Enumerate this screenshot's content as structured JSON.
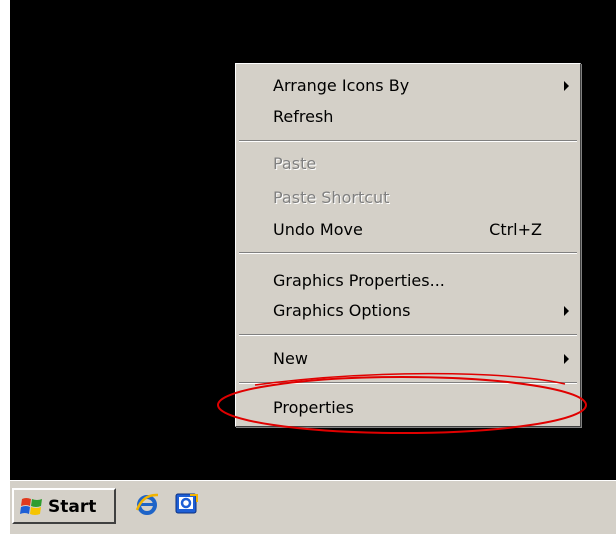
{
  "context_menu": {
    "items": [
      {
        "label": "Arrange Icons By",
        "shortcut": "",
        "submenu": true,
        "disabled": false
      },
      {
        "label": "Refresh",
        "shortcut": "",
        "submenu": false,
        "disabled": false
      },
      {
        "label": "Paste",
        "shortcut": "",
        "submenu": false,
        "disabled": true
      },
      {
        "label": "Paste Shortcut",
        "shortcut": "",
        "submenu": false,
        "disabled": true
      },
      {
        "label": "Undo Move",
        "shortcut": "Ctrl+Z",
        "submenu": false,
        "disabled": false
      },
      {
        "label": "Graphics Properties...",
        "shortcut": "",
        "submenu": false,
        "disabled": false
      },
      {
        "label": "Graphics Options",
        "shortcut": "",
        "submenu": true,
        "disabled": false
      },
      {
        "label": "New",
        "shortcut": "",
        "submenu": true,
        "disabled": false
      },
      {
        "label": "Properties",
        "shortcut": "",
        "submenu": false,
        "disabled": false
      }
    ]
  },
  "annotation": {
    "color": "#e00000",
    "target": "Properties"
  },
  "taskbar": {
    "start_label": "Start",
    "quick_launch": [
      {
        "icon": "internet-explorer-icon"
      },
      {
        "icon": "show-desktop-icon"
      }
    ]
  },
  "colors": {
    "desktop": "#000000",
    "menu": "#d4d0c8",
    "disabled_text": "#808080"
  }
}
